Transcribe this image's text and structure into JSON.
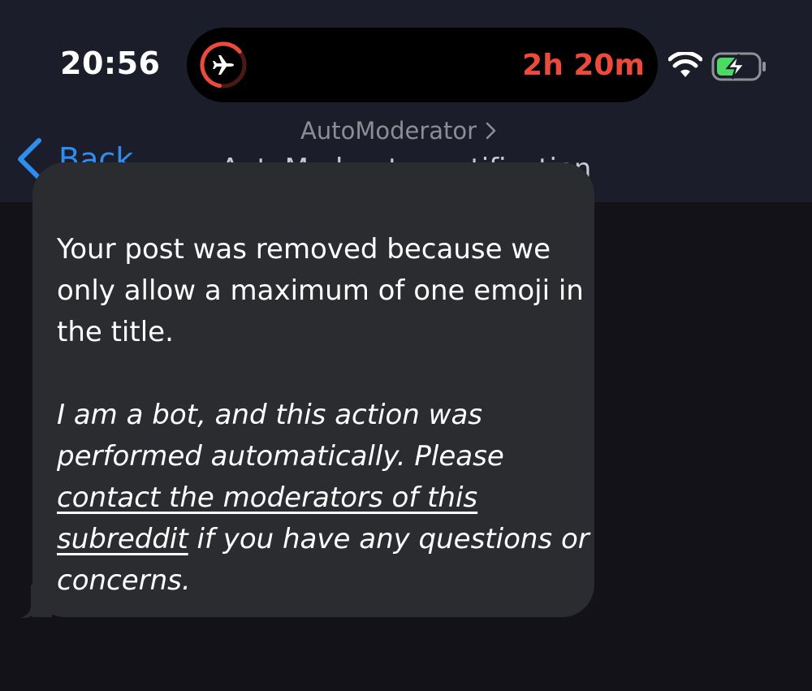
{
  "status_bar": {
    "time": "20:56",
    "flight_remaining": "2h 20m",
    "flight_icon": "airplane-icon",
    "wifi_icon": "wifi-icon",
    "battery_icon": "battery-charging-icon",
    "colors": {
      "flight_accent": "#ec4b3c",
      "battery_fill": "#4cd964"
    }
  },
  "nav": {
    "back_label": "Back",
    "subtitle": "AutoModerator",
    "title": "AutoModerator notification",
    "back_color": "#2f8df0"
  },
  "message": {
    "paragraph_1": "Your post was removed because we only allow a maximum of one emoji in the title.",
    "paragraph_2_before": "I am a bot, and this action was performed automatically. Please ",
    "link_text": "contact the moderators of this subreddit",
    "paragraph_2_after": " if you have any questions or concerns."
  }
}
